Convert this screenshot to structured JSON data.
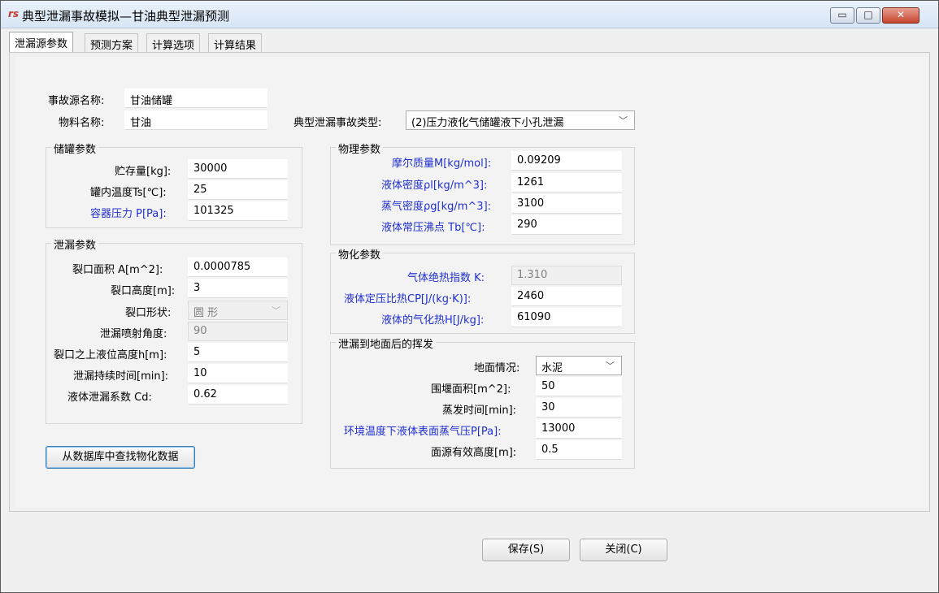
{
  "window": {
    "title": "典型泄漏事故模拟—甘油典型泄漏预测",
    "app_icon": "rs",
    "controls": {
      "minimize": "▭",
      "maximize": "□",
      "close": "✕"
    }
  },
  "tabs": [
    "泄漏源参数",
    "预测方案",
    "计算选项",
    "计算结果"
  ],
  "source": {
    "name_label": "事故源名称:",
    "name_value": "甘油储罐",
    "material_label": "物料名称:",
    "material_value": "甘油",
    "accident_type_label": "典型泄漏事故类型:",
    "accident_type_value": "(2)压力液化气储罐液下小孔泄漏"
  },
  "tank": {
    "title": "储罐参数",
    "storage_label": "贮存量[kg]:",
    "storage_value": "30000",
    "temp_label": "罐内温度Ts[℃]:",
    "temp_value": "25",
    "pressure_label": "容器压力 P[Pa]:",
    "pressure_value": "101325"
  },
  "leak": {
    "title": "泄漏参数",
    "area_label": "裂口面积 A[m^2]:",
    "area_value": "0.0000785",
    "height_label": "裂口高度[m]:",
    "height_value": "3",
    "shape_label": "裂口形状:",
    "shape_value": "圆  形",
    "angle_label": "泄漏喷射角度:",
    "angle_value": "90",
    "level_label": "裂口之上液位高度h[m]:",
    "level_value": "5",
    "duration_label": "泄漏持续时间[min]:",
    "duration_value": "10",
    "cd_label": "液体泄漏系数  Cd:",
    "cd_value": "0.62"
  },
  "physical": {
    "title": "物理参数",
    "molar_label": "摩尔质量M[kg/mol]:",
    "molar_value": "0.09209",
    "liquid_density_label": "液体密度ρl[kg/m^3]:",
    "liquid_density_value": "1261",
    "vapor_density_label": "蒸气密度ρg[kg/m^3]:",
    "vapor_density_value": "3100",
    "boiling_label": "液体常压沸点 Tb[℃]:",
    "boiling_value": "290"
  },
  "chemical": {
    "title": "物化参数",
    "k_label": "气体绝热指数  K:",
    "k_value": "1.310",
    "cp_label": "液体定压比热CP[J/(kg·K)]:",
    "cp_value": "2460",
    "h_label": "液体的气化热H[J/kg]:",
    "h_value": "61090"
  },
  "evaporation": {
    "title": "泄漏到地面后的挥发",
    "ground_label": "地面情况:",
    "ground_value": "水泥",
    "bund_label": "围堰面积[m^2]:",
    "bund_value": "50",
    "evap_time_label": "蒸发时间[min]:",
    "evap_time_value": "30",
    "vapor_pressure_label": "环境温度下液体表面蒸气压P[Pa]:",
    "vapor_pressure_value": "13000",
    "height_label": "面源有效高度[m]:",
    "height_value": "0.5"
  },
  "buttons": {
    "lookup": "从数据库中查找物化数据",
    "save": "保存(S)",
    "close": "关闭(C)"
  }
}
